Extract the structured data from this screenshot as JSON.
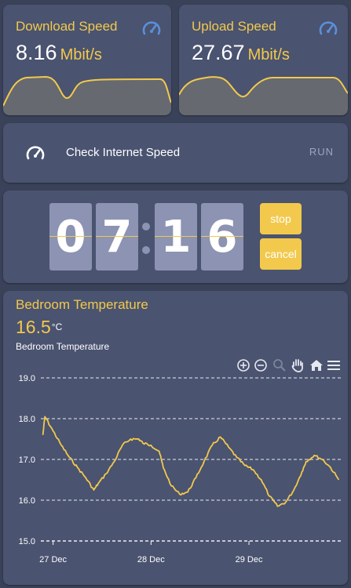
{
  "download": {
    "title": "Download Speed",
    "value": "8.16",
    "unit": "Mbit/s",
    "icon": "speedometer-icon"
  },
  "upload": {
    "title": "Upload Speed",
    "value": "27.67",
    "unit": "Mbit/s",
    "icon": "speedometer-icon"
  },
  "check": {
    "label": "Check Internet Speed",
    "run_label": "RUN",
    "icon": "speedometer-icon"
  },
  "clock": {
    "digits": [
      "0",
      "7",
      "1",
      "6"
    ],
    "stop_label": "stop",
    "cancel_label": "cancel"
  },
  "temperature": {
    "title": "Bedroom Temperature",
    "value": "16.5",
    "unit": "°C",
    "subtitle": "Bedroom Temperature",
    "toolbar": [
      "zoom-in-icon",
      "zoom-out-icon",
      "zoom-select-icon",
      "pan-hand-icon",
      "home-icon",
      "menu-icon"
    ]
  },
  "colors": {
    "accent": "#f2c94c",
    "card": "#4a5370",
    "background": "#3a4259",
    "digit": "#8c93b3"
  },
  "chart_data": {
    "type": "line",
    "ylim": [
      15.0,
      19.0
    ],
    "yticks": [
      "19.0",
      "18.0",
      "17.0",
      "16.0",
      "15.0"
    ],
    "xticks": [
      "27 Dec",
      "28 Dec",
      "29 Dec"
    ],
    "grid": true,
    "series": [
      {
        "x": [
          "2023-12-26T21:30",
          "2023-12-26T22:00",
          "2023-12-27T00:00",
          "2023-12-27T02:00",
          "2023-12-27T04:00",
          "2023-12-27T06:00",
          "2023-12-27T08:00",
          "2023-12-27T10:00",
          "2023-12-27T11:00",
          "2023-12-27T13:00",
          "2023-12-27T15:00",
          "2023-12-27T17:00",
          "2023-12-27T19:00",
          "2023-12-27T21:00",
          "2023-12-27T22:00",
          "2023-12-28T00:00",
          "2023-12-28T02:00",
          "2023-12-28T03:00",
          "2023-12-28T05:00",
          "2023-12-28T07:00",
          "2023-12-28T09:00",
          "2023-12-28T11:00",
          "2023-12-28T13:00",
          "2023-12-28T15:00",
          "2023-12-28T17:00",
          "2023-12-28T19:00",
          "2023-12-28T21:00",
          "2023-12-28T23:00",
          "2023-12-29T01:00",
          "2023-12-29T03:00",
          "2023-12-29T05:00",
          "2023-12-29T07:00",
          "2023-12-29T09:00",
          "2023-12-29T11:00",
          "2023-12-29T13:00",
          "2023-12-29T14:00",
          "2023-12-29T16:00",
          "2023-12-29T18:00",
          "2023-12-29T20:00",
          "2023-12-29T22:00"
        ],
        "y": [
          17.6,
          18.05,
          17.7,
          17.35,
          17.05,
          16.8,
          16.55,
          16.25,
          16.4,
          16.65,
          16.95,
          17.35,
          17.5,
          17.5,
          17.4,
          17.35,
          17.2,
          16.8,
          16.35,
          16.15,
          16.2,
          16.55,
          16.95,
          17.35,
          17.55,
          17.3,
          17.05,
          16.85,
          16.75,
          16.5,
          16.1,
          15.85,
          15.95,
          16.25,
          16.7,
          16.95,
          17.1,
          17.0,
          16.8,
          16.5
        ]
      }
    ]
  }
}
